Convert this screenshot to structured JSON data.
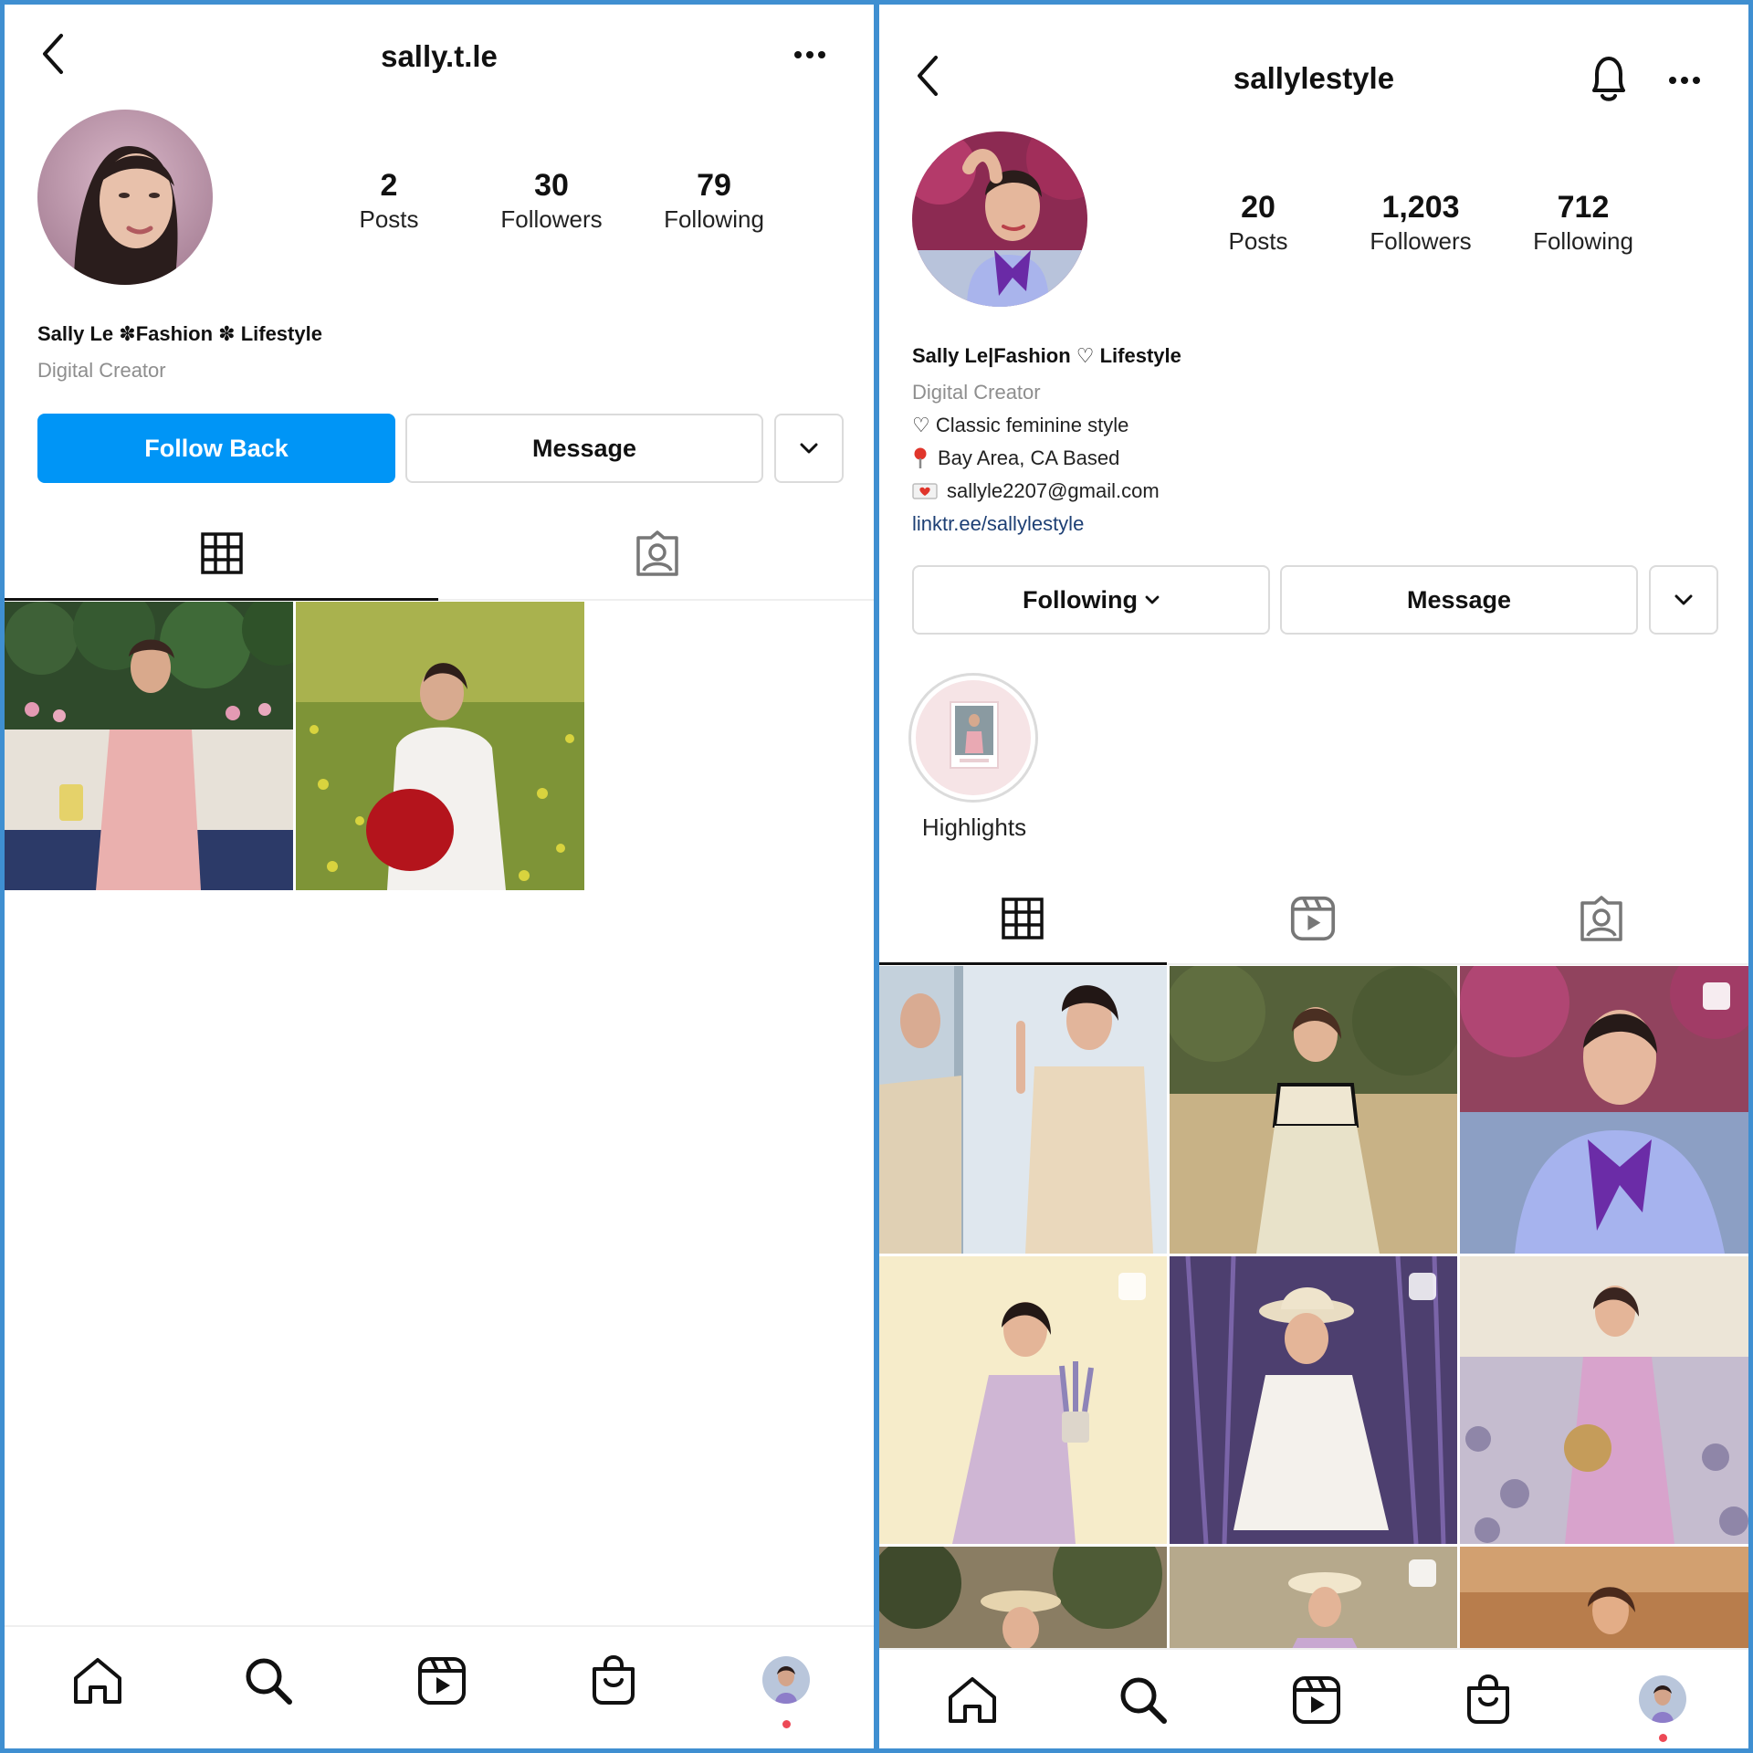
{
  "left": {
    "username": "sally.t.le",
    "stats": [
      {
        "value": "2",
        "label": "Posts"
      },
      {
        "value": "30",
        "label": "Followers"
      },
      {
        "value": "79",
        "label": "Following"
      }
    ],
    "display_name": "Sally Le ✽Fashion ✽ Lifestyle",
    "category": "Digital Creator",
    "buttons": {
      "primary": "Follow Back",
      "secondary": "Message"
    },
    "tabs": [
      "grid-icon",
      "tagged-icon"
    ],
    "posts": [
      "photo: woman in pink dress sitting on bench",
      "photo: woman in white sweater holding red hat in flower field"
    ]
  },
  "right": {
    "username": "sallylestyle",
    "stats": [
      {
        "value": "20",
        "label": "Posts"
      },
      {
        "value": "1,203",
        "label": "Followers"
      },
      {
        "value": "712",
        "label": "Following"
      }
    ],
    "display_name": "Sally Le|Fashion ♡ Lifestyle",
    "category": "Digital Creator",
    "bio_lines": [
      "♡ Classic feminine style",
      "Bay Area, CA Based",
      "sallyle2207@gmail.com"
    ],
    "link": "linktr.ee/sallylestyle",
    "buttons": {
      "primary": "Following",
      "secondary": "Message"
    },
    "highlight_label": "Highlights",
    "tabs": [
      "grid-icon",
      "reels-icon",
      "tagged-icon"
    ]
  },
  "nav_icons": [
    "home-icon",
    "search-icon",
    "reels-icon",
    "shop-icon",
    "profile-avatar"
  ],
  "colors": {
    "primary_blue": "#0095f6",
    "link_blue": "#1d3f74",
    "notification_red": "#ed4956",
    "frame_blue": "#3f8fd1"
  }
}
